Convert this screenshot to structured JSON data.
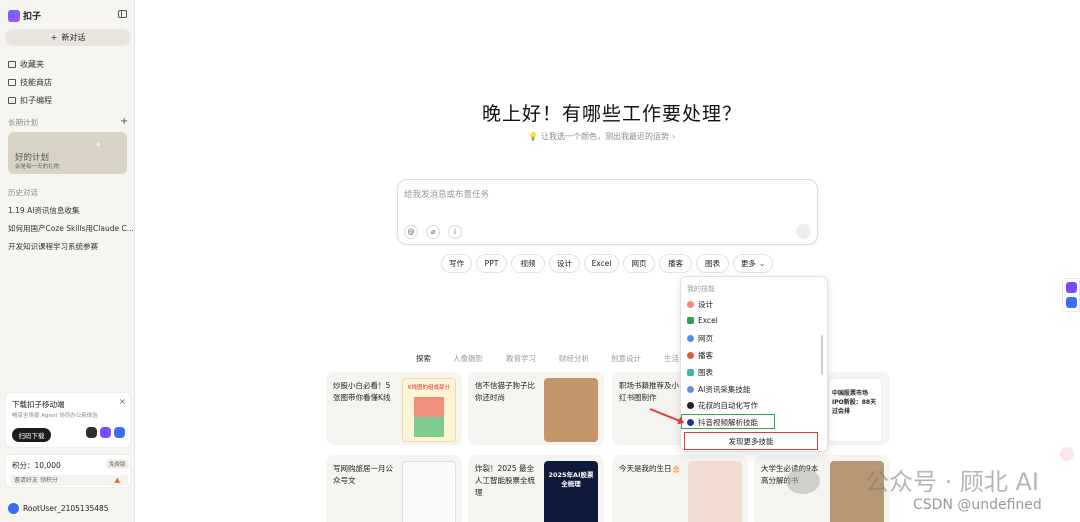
{
  "app": {
    "name": "扣子"
  },
  "sidebar": {
    "new_chat": "新对话",
    "nav": [
      {
        "label": "收藏夹",
        "icon": "folder-icon"
      },
      {
        "label": "技能商店",
        "icon": "store-icon"
      },
      {
        "label": "扣子编程",
        "icon": "code-icon"
      }
    ],
    "long_term_label": "长期计划",
    "plan_title": "好的计划",
    "plan_sub": "会是每一天的礼物",
    "history_label": "历史对话",
    "history": [
      "1.19 AI资讯信息收集",
      "如何用国产Coze Skills用Claude C...",
      "开发知识课程学习系统参赛"
    ],
    "mobile": {
      "title": "下载扣子移动端",
      "sub": "畅享全场景 Agent 协同办公新体验",
      "button": "扫码下载"
    },
    "points": {
      "label": "积分：",
      "value": "10,000",
      "badge": "免费版",
      "invite": "邀请好友 领积分"
    },
    "user": "RootUser_2105135485"
  },
  "main": {
    "greeting": "晚上好！有哪些工作要处理？",
    "hint": "让我选一个颜色，测出我最近的运势",
    "input_placeholder": "给我发消息或布置任务",
    "chips": [
      "写作",
      "PPT",
      "视频",
      "设计",
      "Excel",
      "网页",
      "播客",
      "图表",
      "更多"
    ],
    "tabs": [
      "探索",
      "人像摄影",
      "教育学习",
      "财经分析",
      "创意设计",
      "生活"
    ],
    "cards": [
      "炒股小白必看！5张图带你看懂K线",
      "信不信猫子狗子比你还时尚",
      "职场书籍推荐及小红书图制作",
      "中国股票市场IPO新股：88天过会排",
      "写网购旅居一月公众号文",
      "炸裂！2025 最全人工智能股票全梳理",
      "今天是我的生日🎂",
      "大学生必读的9本高分解的书"
    ],
    "card_image_text": [
      "K线图的组成部分",
      "2025年AI股票全梳理"
    ]
  },
  "dropdown": {
    "header": "我的技能",
    "items": [
      {
        "label": "设计",
        "color": "#f08a7a"
      },
      {
        "label": "Excel",
        "color": "#2f9e50"
      },
      {
        "label": "网页",
        "color": "#4a90e2"
      },
      {
        "label": "播客",
        "color": "#e05a4a"
      },
      {
        "label": "图表",
        "color": "#39b7a5"
      },
      {
        "label": "AI资讯采集技能",
        "color": "#6a8fd6"
      },
      {
        "label": "花叔的自动化写作",
        "color": "#222222"
      },
      {
        "label": "抖音视频解析技能",
        "color": "#1a3a8a"
      }
    ],
    "discover": "发现更多技能"
  },
  "watermark": {
    "main": "公众号 · 顾北 AI",
    "sub": "CSDN @undefined"
  }
}
